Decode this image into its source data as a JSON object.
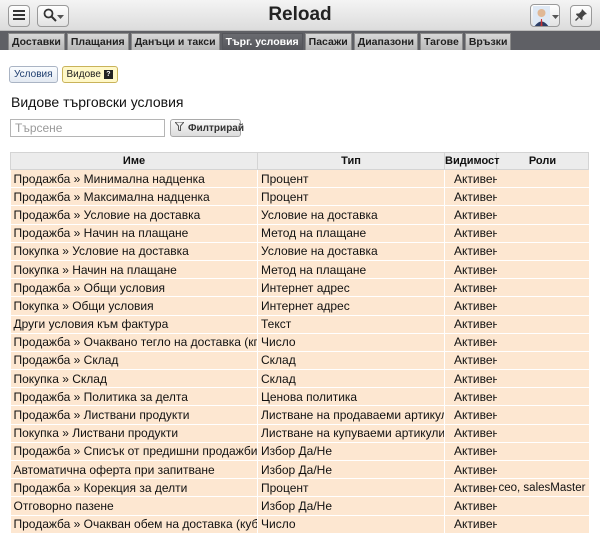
{
  "app": {
    "title": "Reload"
  },
  "tabs": [
    {
      "label": "Доставки",
      "active": false
    },
    {
      "label": "Плащания",
      "active": false
    },
    {
      "label": "Данъци и такси",
      "active": false
    },
    {
      "label": "Търг. условия",
      "active": true
    },
    {
      "label": "Пасажи",
      "active": false
    },
    {
      "label": "Диапазони",
      "active": false
    },
    {
      "label": "Тагове",
      "active": false
    },
    {
      "label": "Връзки",
      "active": false
    }
  ],
  "subtabs": {
    "conditions": "Условия",
    "types": "Видове",
    "help": "?"
  },
  "page": {
    "title": "Видове търговски условия"
  },
  "search": {
    "placeholder": "Търсене",
    "filter_label": "Филтрирай"
  },
  "table": {
    "headers": {
      "name": "Име",
      "type": "Тип",
      "visibility": "Видимост",
      "roles": "Роли"
    },
    "rows": [
      {
        "name": "Продажба » Минимална надценка",
        "type": "Процент",
        "visibility": "Активен",
        "roles": ""
      },
      {
        "name": "Продажба » Максимална надценка",
        "type": "Процент",
        "visibility": "Активен",
        "roles": ""
      },
      {
        "name": "Продажба » Условие на доставка",
        "type": "Условие на доставка",
        "visibility": "Активен",
        "roles": ""
      },
      {
        "name": "Продажба » Начин на плащане",
        "type": "Метод на плащане",
        "visibility": "Активен",
        "roles": ""
      },
      {
        "name": "Покупка » Условие на доставка",
        "type": "Условие на доставка",
        "visibility": "Активен",
        "roles": ""
      },
      {
        "name": "Покупка » Начин на плащане",
        "type": "Метод на плащане",
        "visibility": "Активен",
        "roles": ""
      },
      {
        "name": "Продажба » Общи условия",
        "type": "Интернет адрес",
        "visibility": "Активен",
        "roles": ""
      },
      {
        "name": "Покупка » Общи условия",
        "type": "Интернет адрес",
        "visibility": "Активен",
        "roles": ""
      },
      {
        "name": "Други условия към фактура",
        "type": "Текст",
        "visibility": "Активен",
        "roles": ""
      },
      {
        "name": "Продажба » Очаквано тегло на доставка (кг)",
        "type": "Число",
        "visibility": "Активен",
        "roles": ""
      },
      {
        "name": "Продажба » Склад",
        "type": "Склад",
        "visibility": "Активен",
        "roles": ""
      },
      {
        "name": "Покупка » Склад",
        "type": "Склад",
        "visibility": "Активен",
        "roles": ""
      },
      {
        "name": "Продажба » Политика за делта",
        "type": "Ценова политика",
        "visibility": "Активен",
        "roles": ""
      },
      {
        "name": "Продажба » Листвани продукти",
        "type": "Листване на продаваеми артикули",
        "visibility": "Активен",
        "roles": ""
      },
      {
        "name": "Покупка » Листвани продукти",
        "type": "Листване на купуваеми артикули",
        "visibility": "Активен",
        "roles": ""
      },
      {
        "name": "Продажба » Списък от предишни продажби",
        "type": "Избор Да/Не",
        "visibility": "Активен",
        "roles": ""
      },
      {
        "name": "Автоматична оферта при запитване",
        "type": "Избор Да/Не",
        "visibility": "Активен",
        "roles": ""
      },
      {
        "name": "Продажба » Корекция за делти",
        "type": "Процент",
        "visibility": "Активен",
        "roles": "ceo, salesMaster"
      },
      {
        "name": "Отговорно пазене",
        "type": "Избор Да/Не",
        "visibility": "Активен",
        "roles": ""
      },
      {
        "name": "Продажба » Очакван обем на доставка (куб.м)",
        "type": "Число",
        "visibility": "Активен",
        "roles": ""
      }
    ]
  },
  "colors": {
    "row_bg": "#fde7d1",
    "tabbar_bg": "#5f6065",
    "header_bg": "#ececec"
  }
}
